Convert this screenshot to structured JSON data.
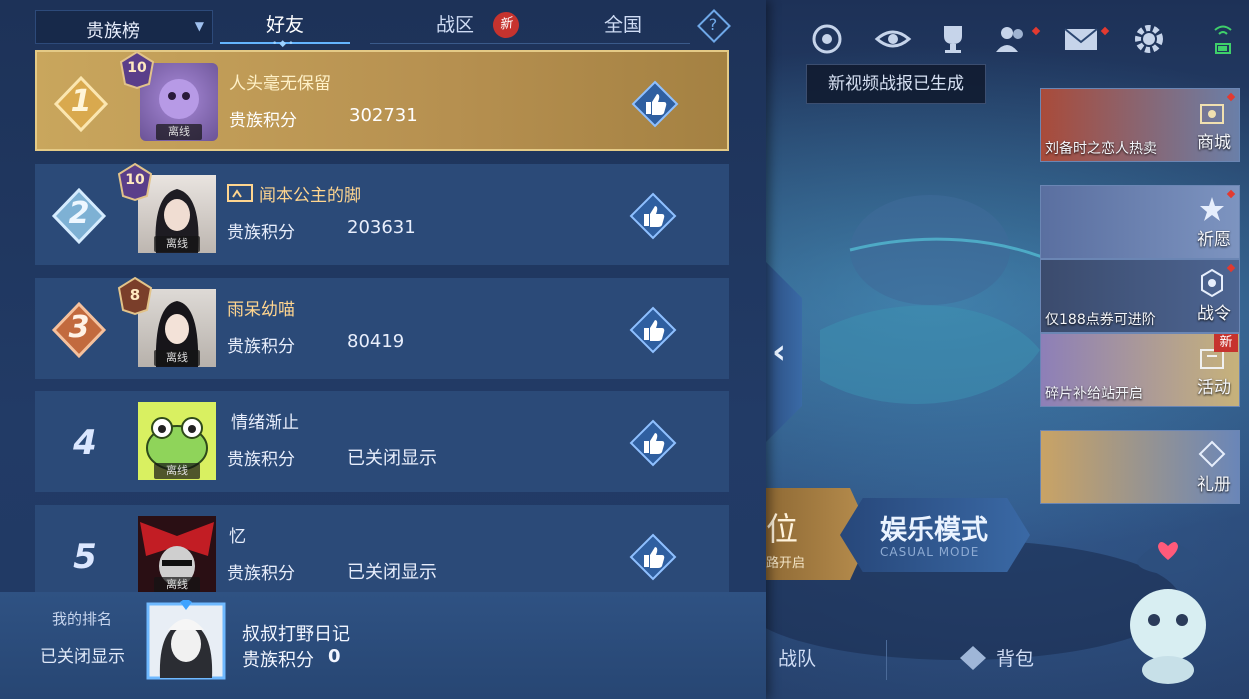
{
  "leaderboard": {
    "dropdown_label": "贵族榜",
    "tabs": [
      {
        "label": "好友",
        "active": true
      },
      {
        "label": "战区",
        "badge": "新"
      },
      {
        "label": "全国"
      }
    ],
    "help_label": "?",
    "rows": [
      {
        "rank": "1",
        "level": "10",
        "name": "人头毫无保留",
        "status": "离线",
        "score_label": "贵族积分",
        "score": "302731"
      },
      {
        "rank": "2",
        "level": "10",
        "name": "闻本公主的脚",
        "status": "离线",
        "score_label": "贵族积分",
        "score": "203631"
      },
      {
        "rank": "3",
        "level": "8",
        "name": "雨呆幼喵",
        "status": "离线",
        "score_label": "贵族积分",
        "score": "80419"
      },
      {
        "rank": "4",
        "name": "情绪渐止",
        "status": "离线",
        "score_label": "贵族积分",
        "score": "已关闭显示"
      },
      {
        "rank": "5",
        "name": "忆",
        "status": "离线",
        "score_label": "贵族积分",
        "score": "已关闭显示"
      }
    ],
    "my_rank": {
      "label": "我的排名",
      "status": "已关闭显示",
      "name": "叔叔打野日记",
      "score_label": "贵族积分",
      "score": "0"
    }
  },
  "game_ui": {
    "tooltip": "新视频战报已生成",
    "side_cards": [
      {
        "caption": "刘备时之恋人热卖",
        "name": "商城"
      },
      {
        "caption": "",
        "name": "祈愿"
      },
      {
        "caption": "仅188点券可进阶",
        "name": "战令"
      },
      {
        "caption": "碎片补给站开启",
        "name": "活动",
        "badge": "新"
      },
      {
        "caption": "",
        "name": "礼册"
      }
    ],
    "mode_left": {
      "title": "位",
      "subtitle": "路开启"
    },
    "mode_right": {
      "title": "娱乐模式",
      "subtitle": "CASUAL MODE"
    },
    "bottom_nav": [
      "战队",
      "背包"
    ],
    "colors": {
      "gold": "#c9a65d",
      "panel": "#223b66",
      "row": "#2b4a78",
      "accent": "#64b5ff",
      "badge_red": "#c6332e"
    }
  }
}
